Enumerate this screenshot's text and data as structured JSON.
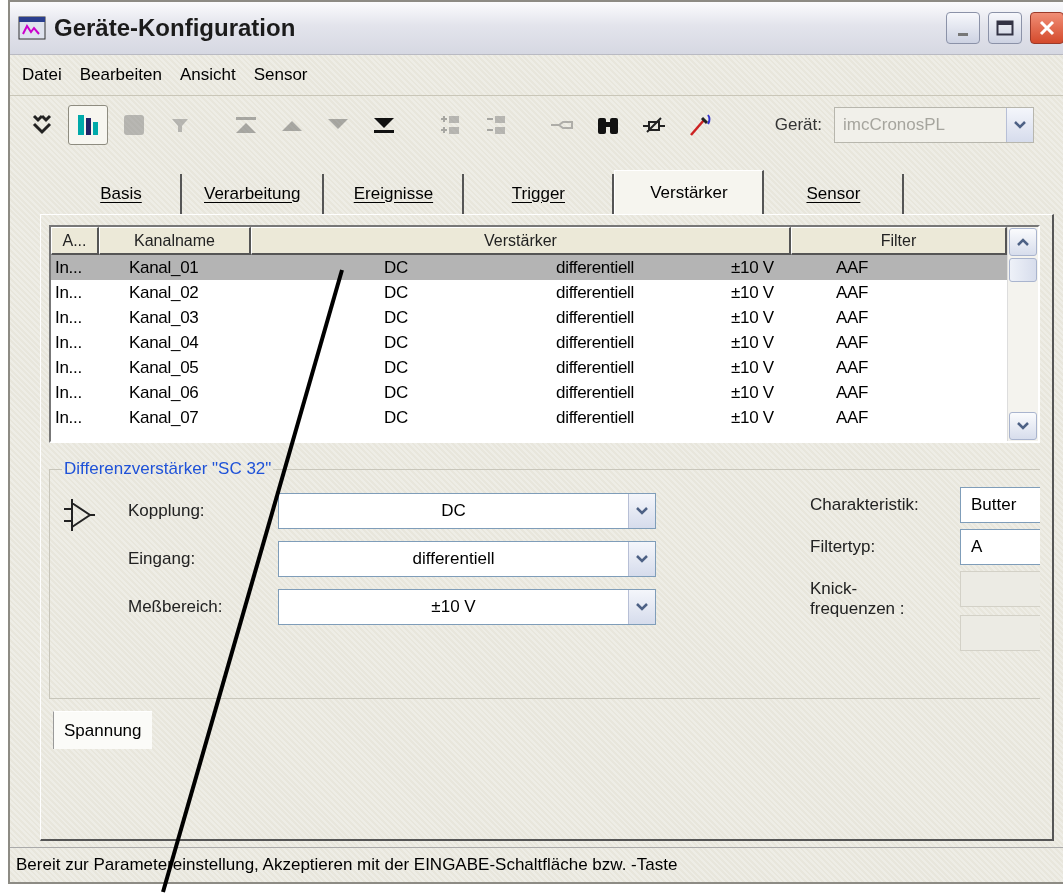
{
  "window": {
    "title": "Geräte-Konfiguration"
  },
  "menu": [
    {
      "label": "Datei"
    },
    {
      "label": "Bearbeiten"
    },
    {
      "label": "Ansicht"
    },
    {
      "label": "Sensor"
    }
  ],
  "toolbar": [
    {
      "kind": "merge",
      "disabled": false,
      "pressed": false
    },
    {
      "kind": "columns",
      "disabled": false,
      "pressed": true
    },
    {
      "kind": "square",
      "disabled": true,
      "pressed": false
    },
    {
      "kind": "funnel",
      "disabled": true,
      "pressed": false
    },
    {
      "kind": "top",
      "disabled": true,
      "pressed": false
    },
    {
      "kind": "up",
      "disabled": true,
      "pressed": false
    },
    {
      "kind": "down",
      "disabled": true,
      "pressed": false
    },
    {
      "kind": "bottom",
      "disabled": false,
      "pressed": false
    },
    {
      "kind": "add",
      "disabled": true,
      "pressed": false
    },
    {
      "kind": "remove",
      "disabled": true,
      "pressed": false
    },
    {
      "kind": "plug",
      "disabled": true,
      "pressed": false
    },
    {
      "kind": "binoculars",
      "disabled": false,
      "pressed": false
    },
    {
      "kind": "sensor",
      "disabled": false,
      "pressed": false
    },
    {
      "kind": "probe",
      "disabled": false,
      "pressed": false
    }
  ],
  "device": {
    "label": "Gerät:",
    "value": "imcCronosPL",
    "disabled": true
  },
  "tabs": [
    {
      "label": "Basis",
      "selected": false
    },
    {
      "label": "Verarbeitung",
      "selected": false
    },
    {
      "label": "Ereignisse",
      "selected": false
    },
    {
      "label": "Trigger",
      "selected": false
    },
    {
      "label": "Verstärker",
      "selected": true
    },
    {
      "label": "Sensor",
      "selected": false
    }
  ],
  "table": {
    "columns": [
      "A...",
      "Kanalname",
      "Verstärker",
      "Filter"
    ],
    "rows": [
      {
        "selected": true,
        "cells": [
          "In...",
          "Kanal_01",
          "DC",
          "differentiell",
          "±10 V",
          "AAF"
        ]
      },
      {
        "selected": false,
        "cells": [
          "In...",
          "Kanal_02",
          "DC",
          "differentiell",
          "±10 V",
          "AAF"
        ]
      },
      {
        "selected": false,
        "cells": [
          "In...",
          "Kanal_03",
          "DC",
          "differentiell",
          "±10 V",
          "AAF"
        ]
      },
      {
        "selected": false,
        "cells": [
          "In...",
          "Kanal_04",
          "DC",
          "differentiell",
          "±10 V",
          "AAF"
        ]
      },
      {
        "selected": false,
        "cells": [
          "In...",
          "Kanal_05",
          "DC",
          "differentiell",
          "±10 V",
          "AAF"
        ]
      },
      {
        "selected": false,
        "cells": [
          "In...",
          "Kanal_06",
          "DC",
          "differentiell",
          "±10 V",
          "AAF"
        ]
      },
      {
        "selected": false,
        "cells": [
          "In...",
          "Kanal_07",
          "DC",
          "differentiell",
          "±10 V",
          "AAF"
        ]
      }
    ]
  },
  "group": {
    "title": "Differenzverstärker \"SC 32\"",
    "left_fields": [
      {
        "label": "Kopplung:",
        "value": "DC"
      },
      {
        "label": "Eingang:",
        "value": "differentiell"
      },
      {
        "label": "Meßbereich:",
        "value": "±10 V"
      }
    ],
    "right_fields": [
      {
        "label": [
          "Charakteristik:"
        ],
        "values": [
          {
            "value": "Butter",
            "disabled": false
          }
        ]
      },
      {
        "label": [
          "Filtertyp:"
        ],
        "values": [
          {
            "value": "A",
            "disabled": false
          }
        ]
      },
      {
        "label": [
          "Knick-",
          "frequenzen :"
        ],
        "values": [
          {
            "disabled": true
          },
          {
            "disabled": true
          }
        ]
      }
    ]
  },
  "inner_tabs": [
    {
      "label": "Spannung",
      "selected": true
    }
  ],
  "status_bar": {
    "text": "Bereit zur Parametereinstellung, Akzeptieren mit der EINGABE-Schaltfläche bzw. -Taste"
  }
}
